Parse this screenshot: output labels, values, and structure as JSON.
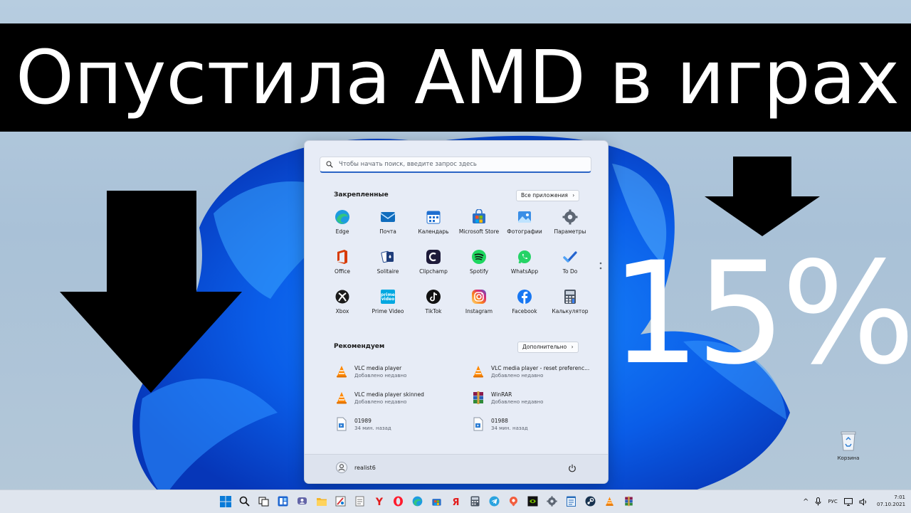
{
  "banner": {
    "title": "Опустила AMD в играх"
  },
  "overlay": {
    "percent": "15%"
  },
  "start_menu": {
    "search_placeholder": "Чтобы начать поиск, введите запрос здесь",
    "pinned_title": "Закрепленные",
    "all_apps_label": "Все приложения",
    "pinned_apps": [
      {
        "label": "Edge",
        "icon": "edge-icon"
      },
      {
        "label": "Почта",
        "icon": "mail-icon"
      },
      {
        "label": "Календарь",
        "icon": "calendar-icon"
      },
      {
        "label": "Microsoft Store",
        "icon": "store-icon"
      },
      {
        "label": "Фотографии",
        "icon": "photos-icon"
      },
      {
        "label": "Параметры",
        "icon": "settings-icon"
      },
      {
        "label": "Office",
        "icon": "office-icon"
      },
      {
        "label": "Solitaire",
        "icon": "solitaire-icon"
      },
      {
        "label": "Clipchamp",
        "icon": "clipchamp-icon"
      },
      {
        "label": "Spotify",
        "icon": "spotify-icon"
      },
      {
        "label": "WhatsApp",
        "icon": "whatsapp-icon"
      },
      {
        "label": "To Do",
        "icon": "todo-icon"
      },
      {
        "label": "Xbox",
        "icon": "xbox-icon"
      },
      {
        "label": "Prime Video",
        "icon": "prime-video-icon"
      },
      {
        "label": "TikTok",
        "icon": "tiktok-icon"
      },
      {
        "label": "Instagram",
        "icon": "instagram-icon"
      },
      {
        "label": "Facebook",
        "icon": "facebook-icon"
      },
      {
        "label": "Калькулятор",
        "icon": "calculator-icon"
      }
    ],
    "recommended_title": "Рекомендуем",
    "more_label": "Дополнительно",
    "recommended": [
      {
        "title": "VLC media player",
        "subtitle": "Добавлено недавно",
        "icon": "vlc-icon"
      },
      {
        "title": "VLC media player - reset preferenc...",
        "subtitle": "Добавлено недавно",
        "icon": "vlc-icon"
      },
      {
        "title": "VLC media player skinned",
        "subtitle": "Добавлено недавно",
        "icon": "vlc-icon"
      },
      {
        "title": "WinRAR",
        "subtitle": "Добавлено недавно",
        "icon": "winrar-icon"
      },
      {
        "title": "01989",
        "subtitle": "34 мин. назад",
        "icon": "video-file-icon"
      },
      {
        "title": "01988",
        "subtitle": "34 мин. назад",
        "icon": "video-file-icon"
      }
    ],
    "user_name": "realist6"
  },
  "desktop": {
    "recycle_bin_label": "Корзина"
  },
  "taskbar": {
    "icons": [
      "start-icon",
      "search-icon",
      "task-view-icon",
      "widgets-icon",
      "chat-icon",
      "file-explorer-icon",
      "paint-icon",
      "folder-icon",
      "yandex-icon",
      "opera-icon",
      "edge-icon",
      "store-icon",
      "yandex-browser-icon",
      "calculator-icon",
      "telegram-icon",
      "vpn-icon",
      "nvidia-icon",
      "settings-icon",
      "notepad-icon",
      "steam-icon",
      "vlc-icon",
      "winrar-icon"
    ],
    "tray_lang": "РУС",
    "time": "7:01",
    "date": "07.10.2021"
  }
}
